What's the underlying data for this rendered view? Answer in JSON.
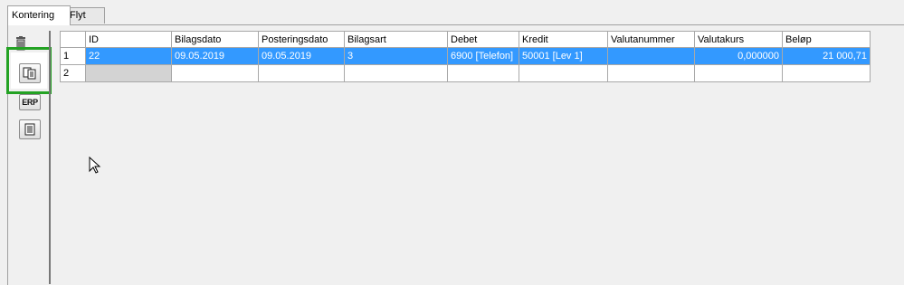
{
  "tabs": [
    {
      "label": "Kontering",
      "active": true
    },
    {
      "label": "Flyt",
      "active": false
    }
  ],
  "toolbar": {
    "delete_icon": "trash-icon",
    "copy_icon": "copy-documents-icon",
    "erp_label": "ERP",
    "document_icon": "document-icon",
    "highlight_color": "#23a223"
  },
  "grid": {
    "columns": [
      "",
      "ID",
      "Bilagsdato",
      "Posteringsdato",
      "Bilagsart",
      "Debet",
      "Kredit",
      "Valutanummer",
      "Valutakurs",
      "Beløp"
    ],
    "rows": [
      {
        "num": "1",
        "id": "22",
        "bilagsdato": "09.05.2019",
        "posteringsdato": "09.05.2019",
        "bilagsart": "3",
        "debet": "6900 [Telefon]",
        "kredit": "50001 [Lev 1]",
        "valutanummer": "",
        "valutakurs": "0,000000",
        "belop": "21 000,71",
        "selected": true
      },
      {
        "num": "2",
        "id": "",
        "bilagsdato": "",
        "posteringsdato": "",
        "bilagsart": "",
        "debet": "",
        "kredit": "",
        "valutanummer": "",
        "valutakurs": "",
        "belop": "",
        "selected": false
      }
    ],
    "selection_color": "#3399ff"
  }
}
